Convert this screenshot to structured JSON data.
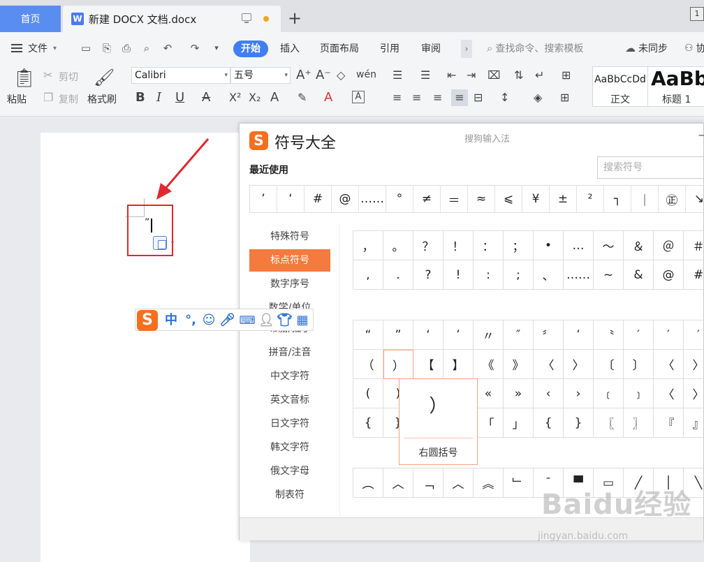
{
  "tabs": {
    "home": "首页",
    "document": "新建 DOCX 文档.docx",
    "doc_icon_letter": "W",
    "add": "+",
    "window_badge": "1"
  },
  "menu": {
    "file": "文件",
    "start": "开始",
    "insert": "插入",
    "page_layout": "页面布局",
    "references": "引用",
    "review": "审阅",
    "search_placeholder": "查找命令、搜索模板",
    "sync": "未同步",
    "share": "协"
  },
  "ribbon": {
    "paste": "粘贴",
    "cut": "剪切",
    "copy": "复制",
    "format_painter": "格式刷",
    "font_name": "Calibri",
    "font_size": "五号",
    "styles": [
      {
        "preview": "AaBbCcDd",
        "name": "正文"
      },
      {
        "preview": "AaBb",
        "name": "标题 1"
      }
    ]
  },
  "document": {
    "typed_char": "”"
  },
  "symbol_window": {
    "title": "符号大全",
    "ime_name": "搜狗输入法",
    "logo": "S",
    "recent_label": "最近使用",
    "search_placeholder": "搜索符号",
    "recent": [
      "’",
      "‘",
      "#",
      "@",
      "……",
      "°",
      "≠",
      "＝",
      "≈",
      "⩽",
      "¥",
      "±",
      "²",
      "┐",
      "｜",
      "㊣",
      "↘"
    ],
    "categories": [
      "特殊符号",
      "标点符号",
      "数字序号",
      "数学/单位",
      "希腊/拉丁",
      "拼音/注音",
      "中文字符",
      "英文音标",
      "日文字符",
      "韩文字符",
      "俄文字母",
      "制表符"
    ],
    "active_category": "标点符号",
    "grid_punct": [
      [
        "，",
        "。",
        "？",
        "！",
        "：",
        "；",
        "•",
        "…",
        "～",
        "＆",
        "＠",
        "＃"
      ],
      [
        ",",
        ".",
        "?",
        "!",
        ":",
        ";",
        "、",
        "……",
        "~",
        "&",
        "@",
        "#"
      ]
    ],
    "grid_quotes": [
      [
        "“",
        "”",
        "‘",
        "’",
        "〃",
        "″",
        "〞",
        "’",
        "〝",
        "′",
        "′",
        "′"
      ],
      [
        "（",
        "）",
        "【",
        "】",
        "《",
        "》",
        "〈",
        "〉",
        "〔",
        "〕",
        "〈",
        "〉"
      ],
      [
        "(",
        ")",
        "",
        "",
        "«",
        "»",
        "‹",
        "›",
        "﹝",
        "﹞",
        "〈",
        "〉"
      ],
      [
        "{",
        "}",
        "",
        "",
        "「",
        "」",
        "{",
        "}",
        "〖",
        "〗",
        "『",
        "』"
      ]
    ],
    "grid_lines": [
      "︵",
      "︿",
      "﹁",
      "︿",
      "︽",
      "﹂",
      "ˉ",
      "▀",
      "▭",
      "╱",
      "│",
      "╲"
    ],
    "tooltip_char": "）",
    "tooltip_label": "右圆括号"
  },
  "ime_toolbar": {
    "logo": "S",
    "mode": "中",
    "punct": "°,"
  },
  "watermark": {
    "brand": "Baidu经验",
    "url": "jingyan.baidu.com"
  }
}
